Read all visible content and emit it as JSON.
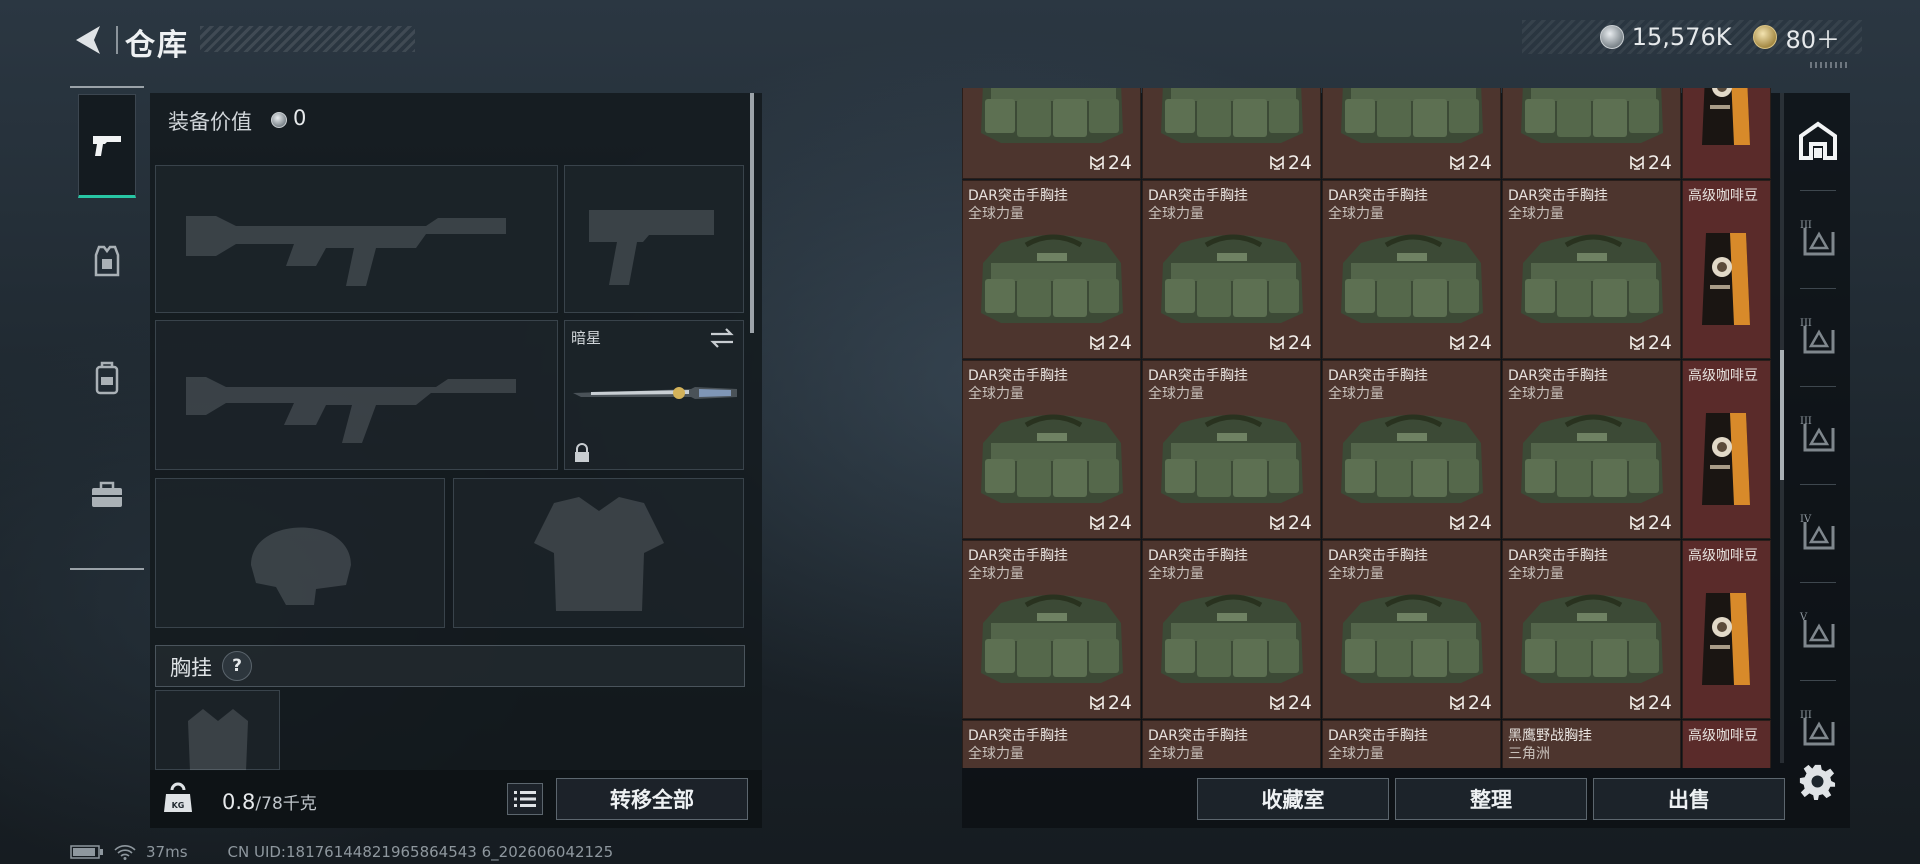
{
  "header": {
    "title": "仓库",
    "currency": [
      {
        "icon": "silver-coin-icon",
        "value": "15,576K"
      },
      {
        "icon": "gold-token-icon",
        "value": "80＋"
      }
    ]
  },
  "left_nav": {
    "items": [
      {
        "name": "weapons-tab",
        "icon": "pistol-icon",
        "active": true
      },
      {
        "name": "armor-tab",
        "icon": "armor-vest-icon",
        "active": false
      },
      {
        "name": "backpack-tab",
        "icon": "backpack-icon",
        "active": false
      },
      {
        "name": "case-tab",
        "icon": "toolbox-icon",
        "active": false
      }
    ]
  },
  "equipment": {
    "value_label": "装备价值",
    "value": "0",
    "melee_name": "暗星",
    "chest_rig_label": "胸挂",
    "help": "?",
    "weight_value": "0.8",
    "weight_max": "/78千克",
    "transfer_all": "转移全部"
  },
  "storage": {
    "rows": [
      {
        "cells": [
          {
            "name": "",
            "brand": "",
            "qty": "24"
          },
          {
            "name": "",
            "brand": "",
            "qty": "24"
          },
          {
            "name": "",
            "brand": "",
            "qty": "24"
          },
          {
            "name": "",
            "brand": "",
            "qty": "24"
          }
        ],
        "coffee": ""
      },
      {
        "cells": [
          {
            "name": "DAR突击手胸挂",
            "brand": "全球力量",
            "qty": "24"
          },
          {
            "name": "DAR突击手胸挂",
            "brand": "全球力量",
            "qty": "24"
          },
          {
            "name": "DAR突击手胸挂",
            "brand": "全球力量",
            "qty": "24"
          },
          {
            "name": "DAR突击手胸挂",
            "brand": "全球力量",
            "qty": "24"
          }
        ],
        "coffee": "高级咖啡豆"
      },
      {
        "cells": [
          {
            "name": "DAR突击手胸挂",
            "brand": "全球力量",
            "qty": "24"
          },
          {
            "name": "DAR突击手胸挂",
            "brand": "全球力量",
            "qty": "24"
          },
          {
            "name": "DAR突击手胸挂",
            "brand": "全球力量",
            "qty": "24"
          },
          {
            "name": "DAR突击手胸挂",
            "brand": "全球力量",
            "qty": "24"
          }
        ],
        "coffee": "高级咖啡豆"
      },
      {
        "cells": [
          {
            "name": "DAR突击手胸挂",
            "brand": "全球力量",
            "qty": "24"
          },
          {
            "name": "DAR突击手胸挂",
            "brand": "全球力量",
            "qty": "24"
          },
          {
            "name": "DAR突击手胸挂",
            "brand": "全球力量",
            "qty": "24"
          },
          {
            "name": "DAR突击手胸挂",
            "brand": "全球力量",
            "qty": "24"
          }
        ],
        "coffee": "高级咖啡豆"
      },
      {
        "cells": [
          {
            "name": "DAR突击手胸挂",
            "brand": "全球力量",
            "qty": ""
          },
          {
            "name": "DAR突击手胸挂",
            "brand": "全球力量",
            "qty": ""
          },
          {
            "name": "DAR突击手胸挂",
            "brand": "全球力量",
            "qty": ""
          },
          {
            "name": "黑鹰野战胸挂",
            "brand": "三角洲",
            "qty": ""
          }
        ],
        "coffee": "高级咖啡豆"
      }
    ],
    "buttons": {
      "collection": "收藏室",
      "sort": "整理",
      "sell": "出售"
    }
  },
  "right_nav": {
    "items": [
      {
        "name": "storage-main-tab",
        "icon": "storage-house-icon",
        "roman": ""
      },
      {
        "name": "storage-page-3a",
        "icon": "storage-page-icon",
        "roman": "III"
      },
      {
        "name": "storage-page-3b",
        "icon": "storage-page-icon",
        "roman": "III"
      },
      {
        "name": "storage-page-3c",
        "icon": "storage-page-icon",
        "roman": "III"
      },
      {
        "name": "storage-page-4",
        "icon": "storage-page-icon",
        "roman": "IV"
      },
      {
        "name": "storage-page-5",
        "icon": "storage-page-icon",
        "roman": "V"
      },
      {
        "name": "storage-page-3d",
        "icon": "storage-page-icon",
        "roman": "III"
      }
    ]
  },
  "status": {
    "ping": "37ms",
    "uid": "CN UID:18176144821965864543 6_202606042125"
  },
  "colors": {
    "accent": "#28c6a4",
    "cell_bg": "#4d352e",
    "coffee_cell_bg": "#5a2b2a"
  }
}
